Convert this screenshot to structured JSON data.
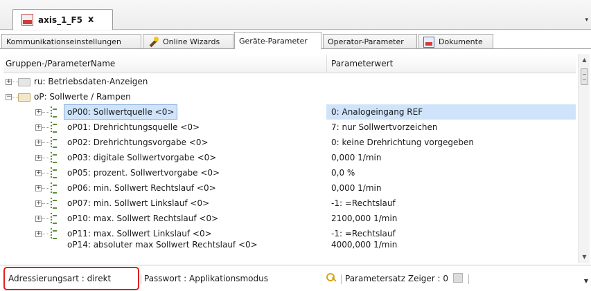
{
  "document_tab": {
    "title": "axis_1_F5",
    "close_label": "x",
    "app_icon": "keb-app-icon"
  },
  "window_menu_arrow": "▾",
  "tabs": [
    {
      "label": "Kommunikationseinstellungen",
      "icon": null,
      "active": false
    },
    {
      "label": "Online Wizards",
      "icon": "wand-icon",
      "active": false
    },
    {
      "label": "Geräte-Parameter",
      "icon": null,
      "active": true
    },
    {
      "label": "Operator-Parameter",
      "icon": null,
      "active": false
    },
    {
      "label": "Dokumente",
      "icon": "documents-icon",
      "active": false
    }
  ],
  "grid": {
    "col_name": "Gruppen-/ParameterName",
    "col_value": "Parameterwert",
    "groups": [
      {
        "label": "ru: Betriebsdaten-Anzeigen",
        "expanded": false
      },
      {
        "label": "oP: Sollwerte / Rampen",
        "expanded": true
      }
    ],
    "rows": [
      {
        "name": "oP00: Sollwertquelle <0>",
        "value": "0: Analogeingang REF",
        "selected": true
      },
      {
        "name": "oP01: Drehrichtungsquelle <0>",
        "value": "7: nur Sollwertvorzeichen"
      },
      {
        "name": "oP02: Drehrichtungsvorgabe <0>",
        "value": "0: keine Drehrichtung vorgegeben"
      },
      {
        "name": "oP03: digitale Sollwertvorgabe <0>",
        "value": "0,000 1/min"
      },
      {
        "name": "oP05: prozent. Sollwertvorgabe <0>",
        "value": "0,0 %"
      },
      {
        "name": "oP06: min. Sollwert Rechtslauf <0>",
        "value": "0,000 1/min"
      },
      {
        "name": "oP07: min. Sollwert Linkslauf <0>",
        "value": "-1: =Rechtslauf"
      },
      {
        "name": "oP10: max. Sollwert Rechtslauf <0>",
        "value": "2100,000 1/min"
      },
      {
        "name": "oP11: max. Sollwert Linkslauf <0>",
        "value": "-1: =Rechtslauf"
      },
      {
        "name": "oP14: absoluter max Sollwert Rechtslauf <0>",
        "value": "4000,000 1/min"
      }
    ]
  },
  "scrollbar": {
    "up": "▲",
    "down": "▼"
  },
  "status": {
    "addressing": "Adressierungsart  : direkt",
    "password": "Passwort : Applikationsmodus",
    "param_set": "Parametersatz Zeiger   : 0",
    "key_icon": "key-icon",
    "highlight_color": "#e02020"
  }
}
